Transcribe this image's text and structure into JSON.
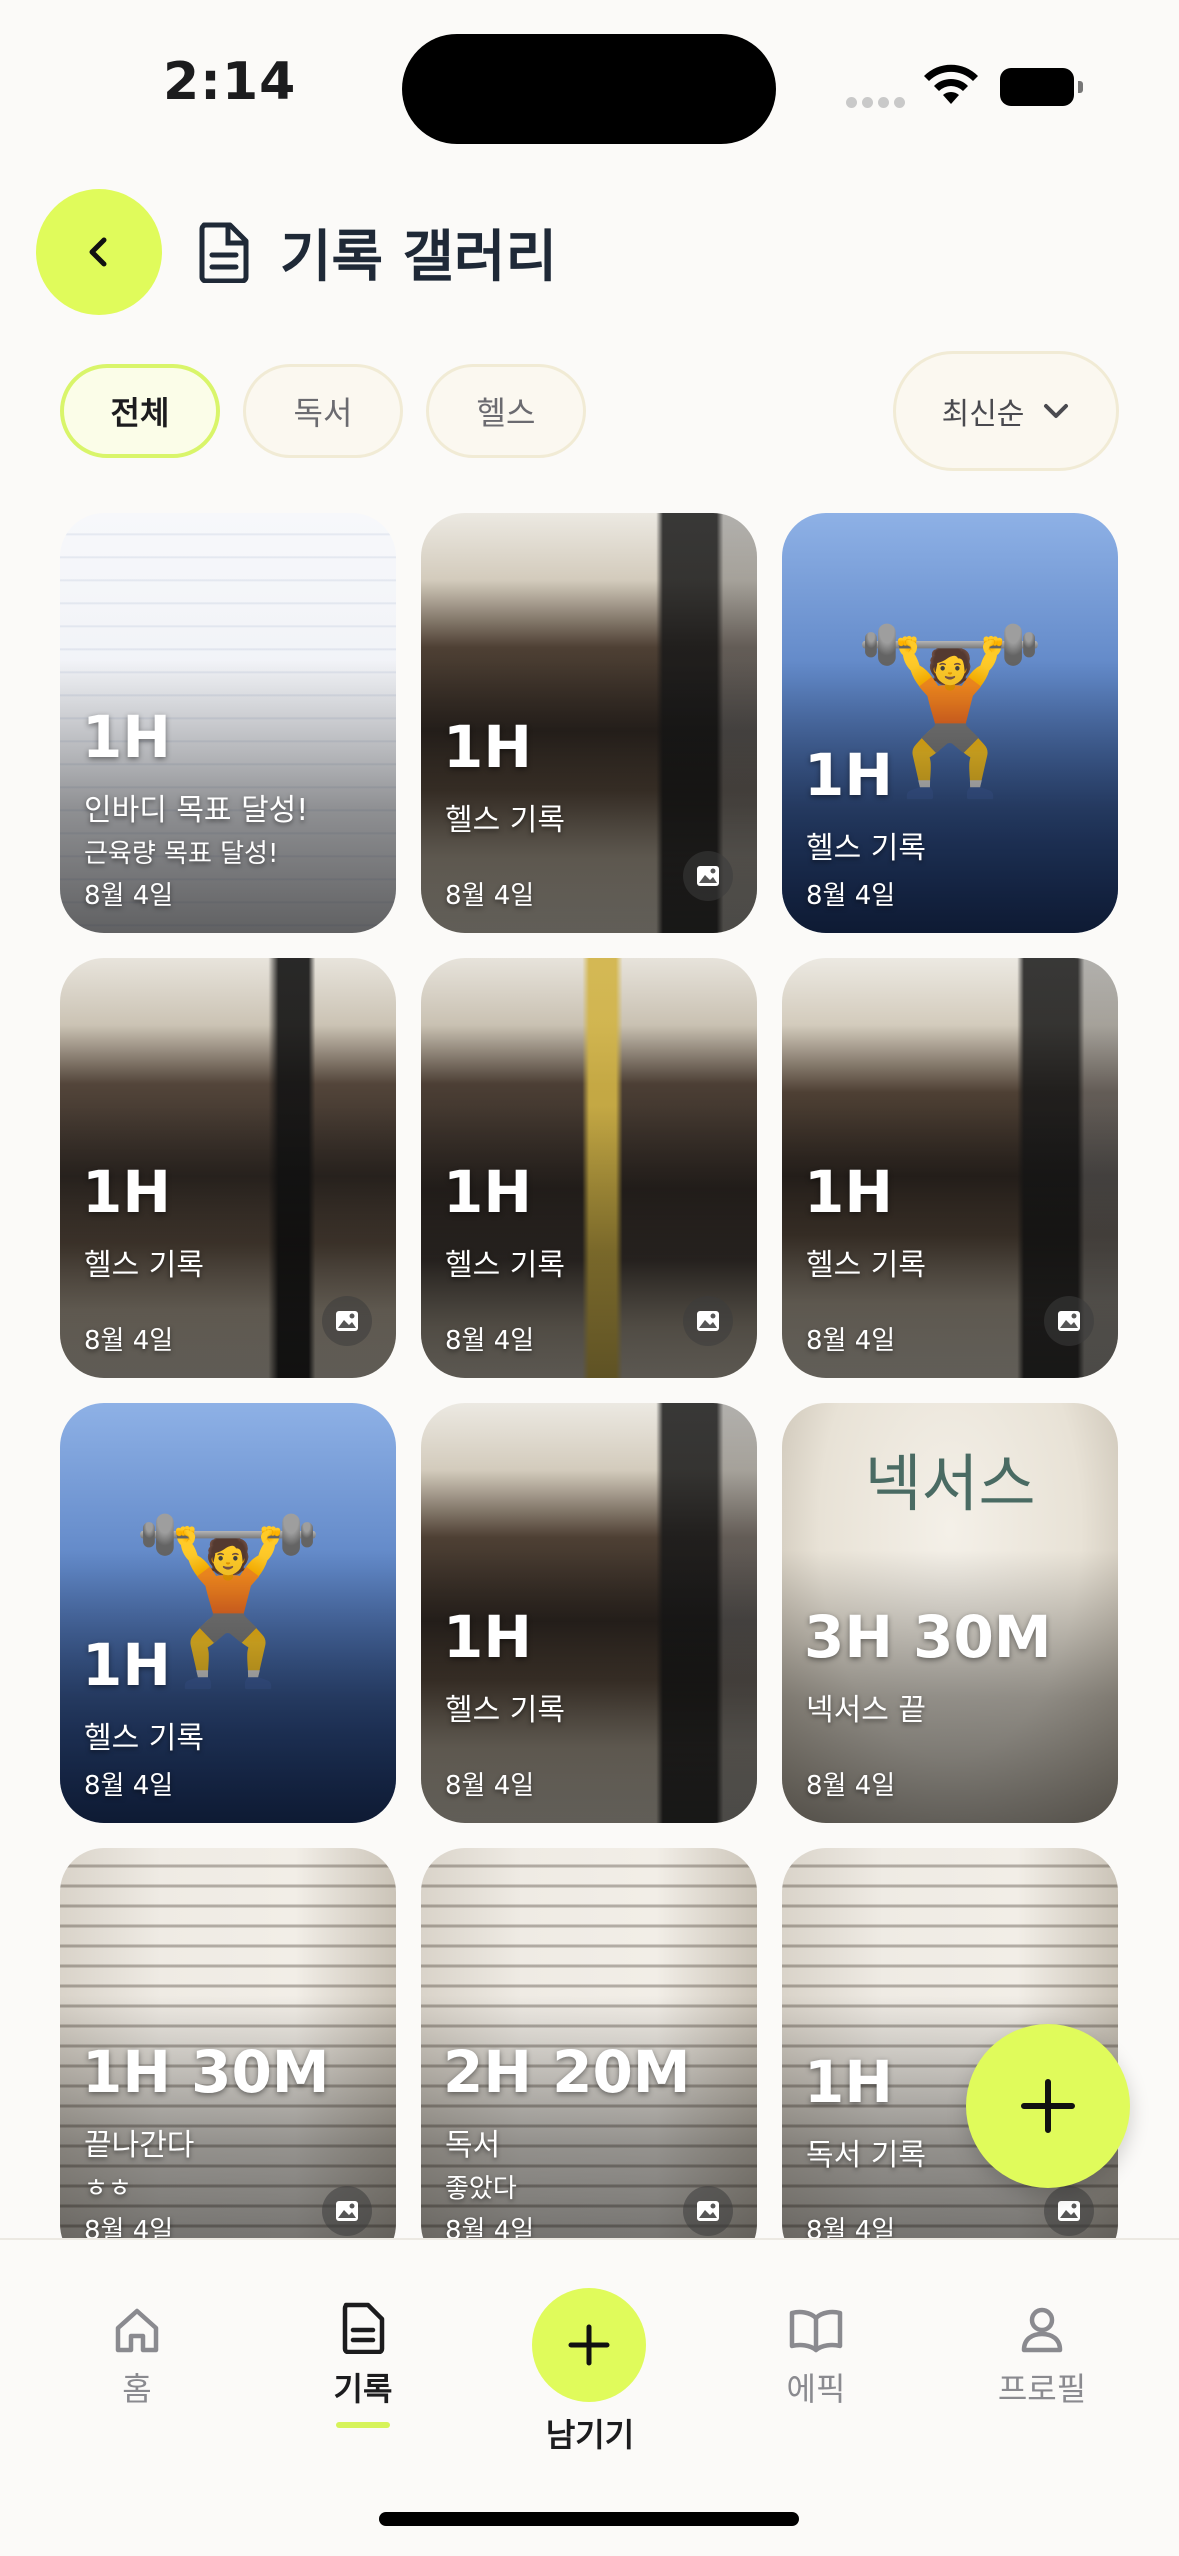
{
  "status_bar": {
    "time": "2:14"
  },
  "header": {
    "title": "기록 갤러리"
  },
  "filters": [
    {
      "label": "전체",
      "active": true
    },
    {
      "label": "독서",
      "active": false
    },
    {
      "label": "헬스",
      "active": false
    }
  ],
  "sort": {
    "label": "최신순"
  },
  "records": [
    {
      "duration": "1H",
      "title": "인바디 목표 달성!",
      "subtitle": "근육량 목표 달성!",
      "date": "8월 4일",
      "bg": "report",
      "photo_badge": false
    },
    {
      "duration": "1H",
      "title": "헬스 기록",
      "subtitle": "",
      "date": "8월 4일",
      "bg": "gym2",
      "photo_badge": true
    },
    {
      "duration": "1H",
      "title": "헬스 기록",
      "subtitle": "",
      "date": "8월 4일",
      "bg": "blue",
      "emoji": "🏋️",
      "photo_badge": false
    },
    {
      "duration": "1H",
      "title": "헬스 기록",
      "subtitle": "",
      "date": "8월 4일",
      "bg": "gym3",
      "photo_badge": true
    },
    {
      "duration": "1H",
      "title": "헬스 기록",
      "subtitle": "",
      "date": "8월 4일",
      "bg": "gym4",
      "photo_badge": true
    },
    {
      "duration": "1H",
      "title": "헬스 기록",
      "subtitle": "",
      "date": "8월 4일",
      "bg": "gym2",
      "photo_badge": true
    },
    {
      "duration": "1H",
      "title": "헬스 기록",
      "subtitle": "",
      "date": "8월 4일",
      "bg": "blue",
      "emoji": "🏋️",
      "photo_badge": false
    },
    {
      "duration": "1H",
      "title": "헬스 기록",
      "subtitle": "",
      "date": "8월 4일",
      "bg": "gym2",
      "photo_badge": false
    },
    {
      "duration": "3H 30M",
      "title": "넥서스 끝",
      "subtitle": "",
      "date": "8월 4일",
      "bg": "book",
      "book_title": "넥서스",
      "photo_badge": false
    },
    {
      "duration": "1H 30M",
      "title": "끝나간다",
      "subtitle": "ㅎㅎ",
      "date": "8월 4일",
      "bg": "page",
      "photo_badge": true
    },
    {
      "duration": "2H 20M",
      "title": "독서",
      "subtitle": "좋았다",
      "date": "8월 4일",
      "bg": "page",
      "photo_badge": true
    },
    {
      "duration": "1H",
      "title": "독서 기록",
      "subtitle": "",
      "date": "8월 4일",
      "bg": "page",
      "photo_badge": true
    }
  ],
  "tab_bar": {
    "home": "홈",
    "records": "기록",
    "add": "남기기",
    "epic": "에픽",
    "profile": "프로필",
    "active": "records"
  },
  "colors": {
    "accent": "#e0fb5b",
    "chip_border": "#f1ebd5"
  }
}
